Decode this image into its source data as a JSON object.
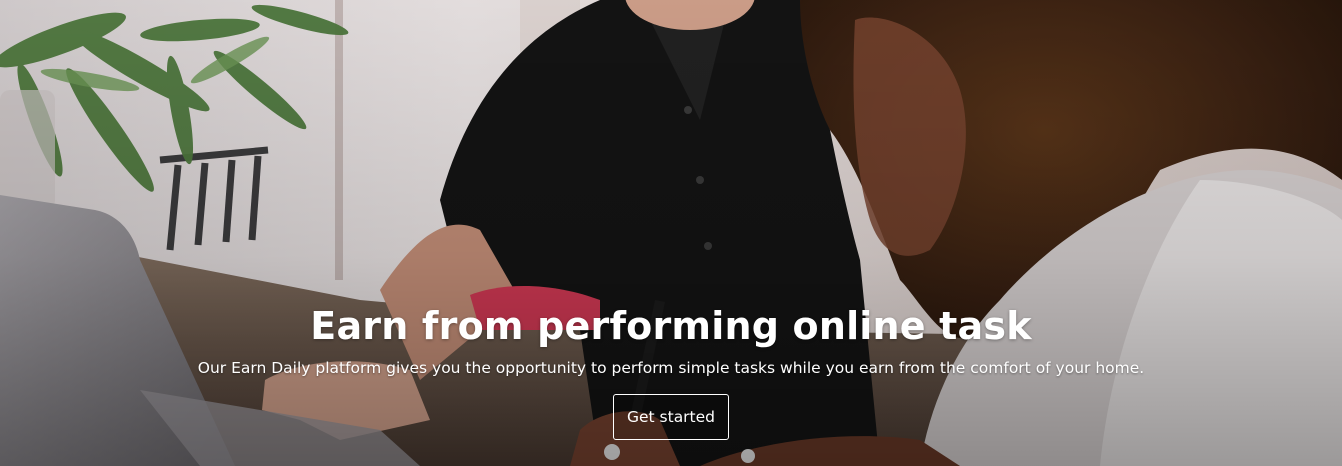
{
  "hero": {
    "title": "Earn from performing online task",
    "subtitle": "Our Earn Daily platform gives you the opportunity to perform simple tasks while you earn from the comfort of your home.",
    "cta_label": "Get started"
  },
  "background_image": {
    "icon": "hero-photo",
    "colors": {
      "wall": "#ece6e6",
      "shirt": "#141414",
      "hair": "#3a2112",
      "skin": "#c79783",
      "laptop": "#8f8c91",
      "plant": "#4f7a3e",
      "table": "#6c5a4e",
      "accent_red": "#d63a56"
    }
  }
}
